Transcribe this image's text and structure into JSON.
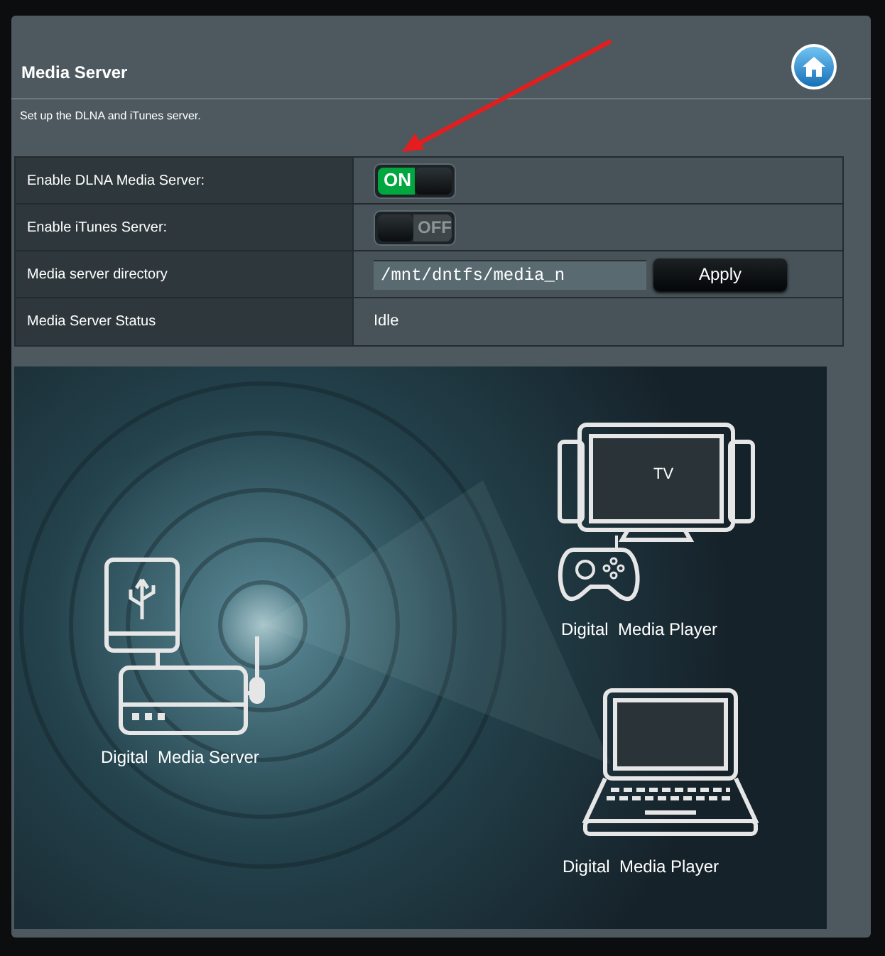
{
  "page": {
    "title": "Media Server",
    "description": "Set up the DLNA and iTunes server."
  },
  "settings": [
    {
      "kind": "switch",
      "label": "Enable DLNA Media Server:",
      "on": true,
      "text": "ON"
    },
    {
      "kind": "switch",
      "label": "Enable iTunes Server:",
      "on": false,
      "text": "OFF"
    },
    {
      "kind": "field",
      "label": "Media server directory",
      "value": "/mnt/dntfs/media_n",
      "button": "Apply"
    },
    {
      "kind": "text",
      "label": "Media Server Status",
      "value": "Idle"
    }
  ],
  "diagram": {
    "server_label": "Digital  Media Server",
    "players": [
      {
        "kind": "tv",
        "screen_text": "TV",
        "label": "Digital  Media Player"
      },
      {
        "kind": "laptop",
        "label": "Digital  Media Player"
      }
    ]
  }
}
